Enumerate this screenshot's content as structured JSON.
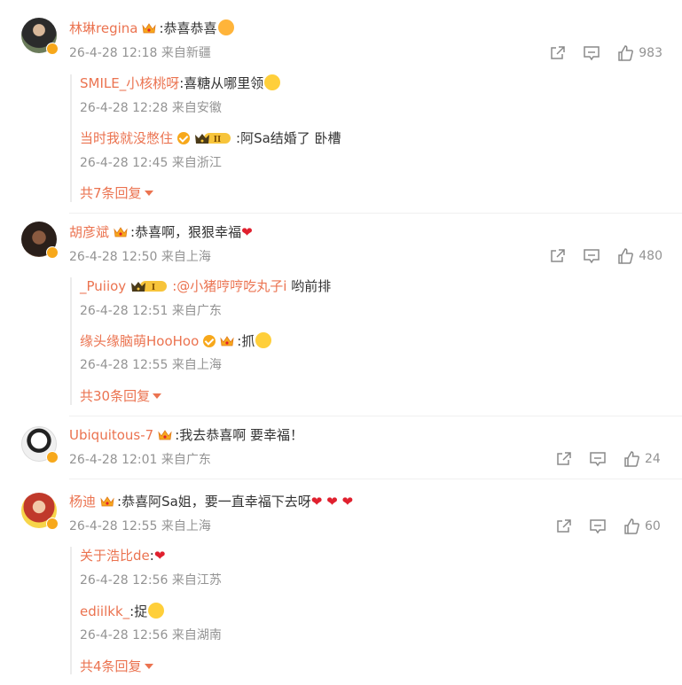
{
  "comments": [
    {
      "user": "林琳regina",
      "text": ":恭喜恭喜",
      "time": "26-4-28 12:18 来自新疆",
      "likes": "983",
      "replies": [
        {
          "user": "SMILE_小核桃呀",
          "text": ":喜糖从哪里领",
          "time": "26-4-28 12:28 来自安徽"
        },
        {
          "user": "当时我就没憋住",
          "text": ":阿Sa结婚了 卧槽",
          "time": "26-4-28 12:45 来自浙江"
        }
      ],
      "more": "共7条回复"
    },
    {
      "user": "胡彦斌",
      "text": ":恭喜啊，狠狠幸福",
      "time": "26-4-28 12:50 来自上海",
      "likes": "480",
      "replies": [
        {
          "user": "_Puiioy",
          "mention": ":@小猪哼哼吃丸子i",
          "text": " 哟前排",
          "time": "26-4-28 12:51 来自广东"
        },
        {
          "user": "缘头缘脑萌HooHoo",
          "text": ":抓",
          "time": "26-4-28 12:55 来自上海"
        }
      ],
      "more": "共30条回复"
    },
    {
      "user": "Ubiquitous-7",
      "text": ":我去恭喜啊 要幸福！",
      "time": "26-4-28 12:01 来自广东",
      "likes": "24"
    },
    {
      "user": "杨迪",
      "text": ":恭喜阿Sa姐，要一直幸福下去呀",
      "time": "26-4-28 12:55 来自上海",
      "likes": "60",
      "replies": [
        {
          "user": "关于浩比de",
          "text": ":",
          "time": "26-4-28 12:56 来自江苏"
        },
        {
          "user": "ediilkk_",
          "text": ":捉",
          "time": "26-4-28 12:56 来自湖南"
        }
      ],
      "more": "共4条回复"
    }
  ],
  "level_badges": {
    "c1": "II",
    "c2": "I"
  },
  "icons": [
    "share-icon",
    "comment-icon",
    "like-icon",
    "crown-icon",
    "verified-icon",
    "heart-icon",
    "emoji-icon",
    "caret-down-icon"
  ],
  "colors": {
    "username": "#eb7350",
    "meta": "#939393",
    "verified": "#f7a81b",
    "heart": "#e0202e"
  }
}
